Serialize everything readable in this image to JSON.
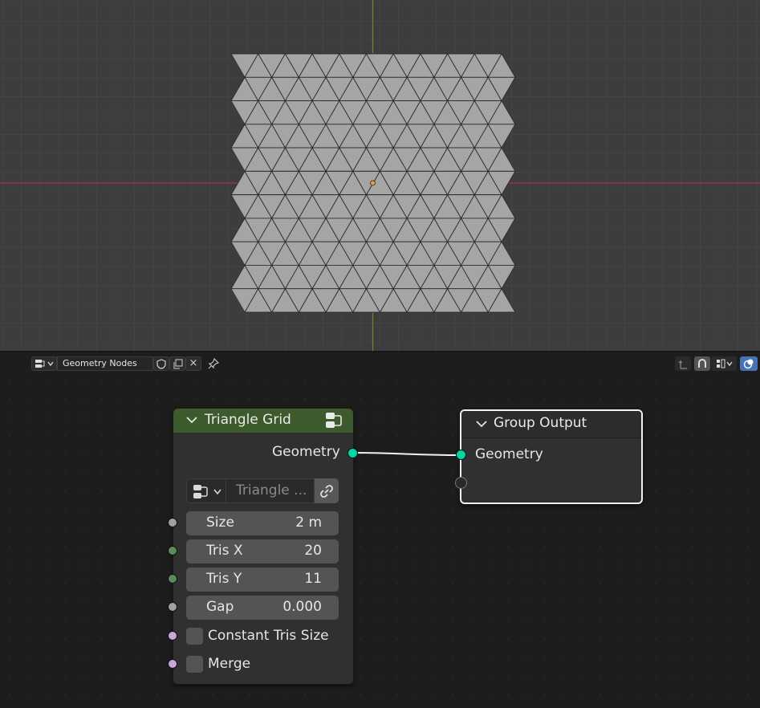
{
  "viewport": {
    "grid_minor_color": "#444444",
    "grid_major_color": "#4c4c4c",
    "axis_x_color": "#9a3c46",
    "axis_y_color": "#6a8a28",
    "mesh_fill": "#a5a5a5",
    "mesh_edge": "#2c2c2c",
    "origin_color": "#e8a13a"
  },
  "header": {
    "tree_name": "Geometry Nodes",
    "tree_type_icon": "node-tree-icon",
    "fake_user_icon": "shield-icon",
    "duplicate_icon": "copy-icon",
    "unlink_icon": "close-icon",
    "unlink_label": "×",
    "pin_icon": "pin-icon",
    "right_icons": [
      "parent-node-tree-icon",
      "snap-icon",
      "snap-mode-icon",
      "overlay-icon"
    ]
  },
  "nodes": {
    "triangle_grid": {
      "title": "Triangle Grid",
      "header_color": "#3c5a2c",
      "output_label": "Geometry",
      "group_name": "Triangle ...",
      "fields": [
        {
          "label": "Size",
          "value": "2 m",
          "socket_color": "#a1a1a1"
        },
        {
          "label": "Tris X",
          "value": "20",
          "socket_color": "#5c8a5c"
        },
        {
          "label": "Tris Y",
          "value": "11",
          "socket_color": "#5c8a5c"
        },
        {
          "label": "Gap",
          "value": "0.000",
          "socket_color": "#a1a1a1"
        }
      ],
      "checkboxes": [
        {
          "label": "Constant Tris Size",
          "checked": false,
          "socket_color": "#cca6d6"
        },
        {
          "label": "Merge",
          "checked": false,
          "socket_color": "#cca6d6"
        }
      ]
    },
    "group_output": {
      "title": "Group Output",
      "input_label": "Geometry"
    },
    "geometry_socket_color": "#00d6a3",
    "link_color": "#f2f2f2"
  }
}
